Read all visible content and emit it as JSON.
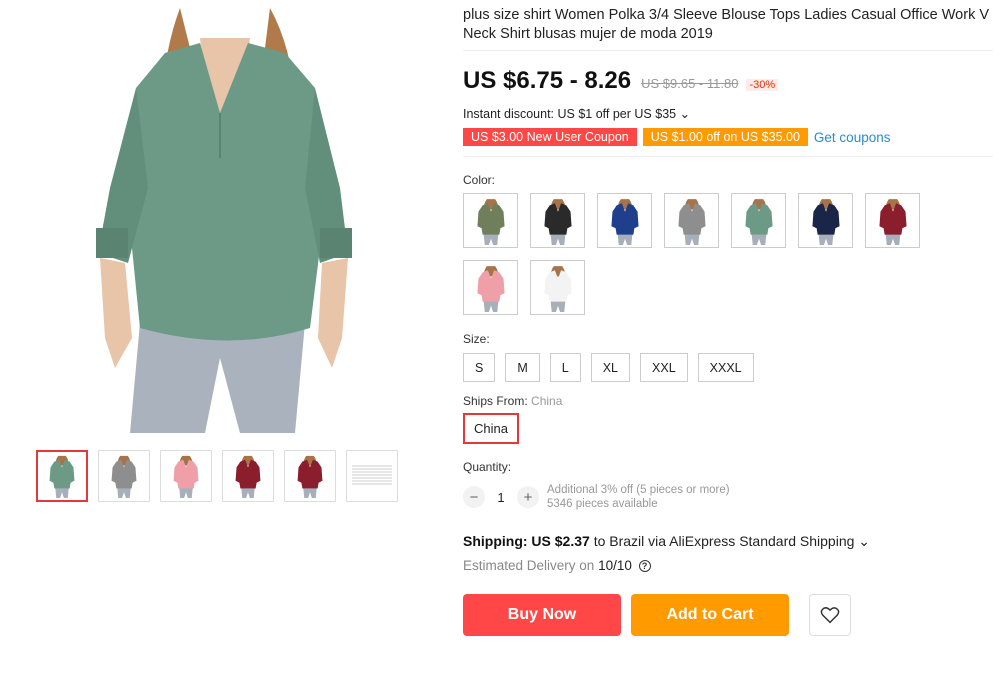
{
  "product": {
    "title": "plus size shirt Women Polka 3/4 Sleeve Blouse Tops Ladies Casual Office Work V Neck Shirt blusas mujer de moda 2019",
    "price": "US $6.75 - 8.26",
    "old_price": "US $9.65 - 11.80",
    "discount": "-30%"
  },
  "promo": {
    "instant_discount": "Instant discount: US $1 off per US $35 ⌄",
    "new_user_coupon": "US $3.00 New User Coupon",
    "spend_coupon": "US $1.00 off on US $35.00",
    "get_coupons": "Get coupons"
  },
  "colors": {
    "label": "Color:",
    "swatches": [
      {
        "name": "green",
        "hex": "#6f7f5c"
      },
      {
        "name": "black",
        "hex": "#2a2a2a"
      },
      {
        "name": "blue",
        "hex": "#1f3f8c"
      },
      {
        "name": "gray",
        "hex": "#8e8e8e"
      },
      {
        "name": "mint",
        "hex": "#6c9a86"
      },
      {
        "name": "navy",
        "hex": "#1b2548"
      },
      {
        "name": "burgundy",
        "hex": "#8b1e2c"
      },
      {
        "name": "pink",
        "hex": "#ef9fa8"
      },
      {
        "name": "white",
        "hex": "#f3f3f3"
      }
    ]
  },
  "sizes": {
    "label": "Size:",
    "options": [
      "S",
      "M",
      "L",
      "XL",
      "XXL",
      "XXXL"
    ]
  },
  "ships_from": {
    "label": "Ships From:",
    "value": "China",
    "option": "China"
  },
  "quantity": {
    "label": "Quantity:",
    "minus": "−",
    "value": "1",
    "plus": "+",
    "note1": "Additional 3% off (5 pieces or more)",
    "note2": "5346 pieces available"
  },
  "shipping": {
    "label": "Shipping: US $2.37",
    "text": " to Brazil via AliExpress Standard Shipping ⌄",
    "delivery_label": "Estimated Delivery on ",
    "delivery_date": "10/10"
  },
  "actions": {
    "buy_now": "Buy Now",
    "add_to_cart": "Add to Cart"
  },
  "gallery": {
    "main_color": "#6c9a86",
    "thumbs": [
      {
        "color": "#6c9a86",
        "active": true
      },
      {
        "color": "#8e8e8e",
        "active": false
      },
      {
        "color": "#ef9fa8",
        "active": false
      },
      {
        "color": "#8b1e2c",
        "active": false
      },
      {
        "color": "#8b1e2c",
        "active": false
      },
      {
        "type": "size-chart-icon",
        "active": false
      }
    ]
  }
}
